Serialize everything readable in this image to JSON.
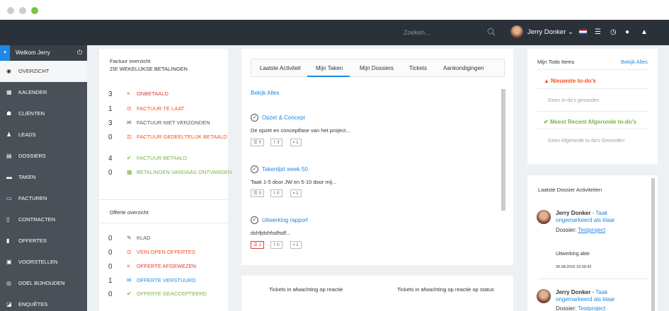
{
  "header": {
    "search_placeholder": "Zoeken...",
    "user_name": "Jerry Donker"
  },
  "sidebar": {
    "welcome": "Welkom Jerry",
    "items": [
      {
        "label": "OVERZICHT",
        "icon": "dashboard-icon",
        "active": true
      },
      {
        "label": "KALENDER",
        "icon": "calendar-icon"
      },
      {
        "label": "CLIËNTEN",
        "icon": "users-icon"
      },
      {
        "label": "LEADS",
        "icon": "leads-icon"
      },
      {
        "label": "DOSSIERS",
        "icon": "folder-icon"
      },
      {
        "label": "TAKEN",
        "icon": "tasks-icon"
      },
      {
        "label": "FACTUREN",
        "icon": "invoice-icon"
      },
      {
        "label": "CONTRACTEN",
        "icon": "contract-icon"
      },
      {
        "label": "OFFERTES",
        "icon": "quote-icon"
      },
      {
        "label": "VOORSTELLEN",
        "icon": "proposal-icon"
      },
      {
        "label": "DOEL BIJHOUDEN",
        "icon": "target-icon"
      },
      {
        "label": "ENQUÊTES",
        "icon": "survey-icon"
      }
    ]
  },
  "invoice_overview": {
    "title": "Factuur overzicht",
    "subtitle": "ZIE WEKELIJKSE BETALINGEN",
    "rows": [
      {
        "count": "3",
        "label": "ONBETAALD",
        "color": "#e53935",
        "icon": "×"
      },
      {
        "count": "1",
        "label": "FACTUUR TE LAAT",
        "color": "#f4511e",
        "icon": "⊙"
      },
      {
        "count": "3",
        "label": "FACTUUR NIET VERZONDEN",
        "color": "#555555",
        "icon": "✉"
      },
      {
        "count": "0",
        "label": "FACTUUR GEDEELTELIJK BETAALD",
        "color": "#f4511e",
        "icon": "⚖"
      },
      {
        "count": "4",
        "label": "FACTUUR BETAALD",
        "color": "#7cb342",
        "icon": "✔"
      },
      {
        "count": "0",
        "label": "BETALINGEN VANDAAG ONTVANGEN",
        "color": "#7cb342",
        "icon": "▦"
      }
    ]
  },
  "quote_overview": {
    "title": "Offerte overzicht",
    "rows": [
      {
        "count": "0",
        "label": "KLAD",
        "color": "#555555",
        "icon": "✎"
      },
      {
        "count": "0",
        "label": "VERLOPEN OFFERTES",
        "color": "#f4511e",
        "icon": "⊙"
      },
      {
        "count": "0",
        "label": "OFFERTE AFGEWEZEN",
        "color": "#e53935",
        "icon": "×"
      },
      {
        "count": "1",
        "label": "OFFERTE VERSTUURD",
        "color": "#1e88e5",
        "icon": "✉"
      },
      {
        "count": "0",
        "label": "OFFERTE GEACCEPTEERD",
        "color": "#7cb342",
        "icon": "✔"
      }
    ]
  },
  "tabs": [
    "Laatste Activiteit",
    "Mijn Taken",
    "Mijn Dossiers",
    "Tickets",
    "Aankondigingen"
  ],
  "tasks_panel": {
    "view_all": "Bekijk Alles",
    "tasks": [
      {
        "title": "Opzet & Concept",
        "desc": "De opzet en conceptfase van het project...",
        "checklist": "0",
        "attachments": "3",
        "comments": "1"
      },
      {
        "title": "Takenlijst week 50",
        "desc": "Taak 1-5 door JW en 5-10 door mij...",
        "checklist": "0",
        "attachments": "0",
        "comments": "1"
      },
      {
        "title": "Uitwerking rapport",
        "desc": "dshfjdshfsdfsdf...",
        "checklist": "2",
        "attachments": "0",
        "comments": "1"
      }
    ]
  },
  "tickets": {
    "left": "Tickets in afwachting op reactie",
    "right": "Tickets in afwachting op reactie op status"
  },
  "todo": {
    "title": "Mijn Todo Items",
    "view_all": "Bekijk Alles",
    "newest": "Nieuwste to-do's",
    "newest_empty": "Geen to-do's gevonden",
    "completed": "Meest Recent Afgeronde to-do's",
    "completed_empty": "Geen Afgeronde to-do's Gevonden"
  },
  "dossier_activity": {
    "title": "Laatste Dossier Activiteiten",
    "items": [
      {
        "name": "Jerry Donker",
        "action": "Taak ongemarkeerd als klaar",
        "dossier_label": "Dossier:",
        "dossier": "Testproject",
        "detail": "Uitwerking akte",
        "time": "30.08.2016 15:09:42"
      },
      {
        "name": "Jerry Donker",
        "action": "Taak ongemarkeerd als klaar",
        "dossier_label": "Dossier:",
        "dossier": "Testproject"
      }
    ]
  },
  "colors": {
    "topbar": "#2b3139",
    "sidebar": "#4a5058",
    "accent": "#1e88e5",
    "danger": "#e53935",
    "warning": "#f4511e",
    "success": "#7cb342"
  }
}
